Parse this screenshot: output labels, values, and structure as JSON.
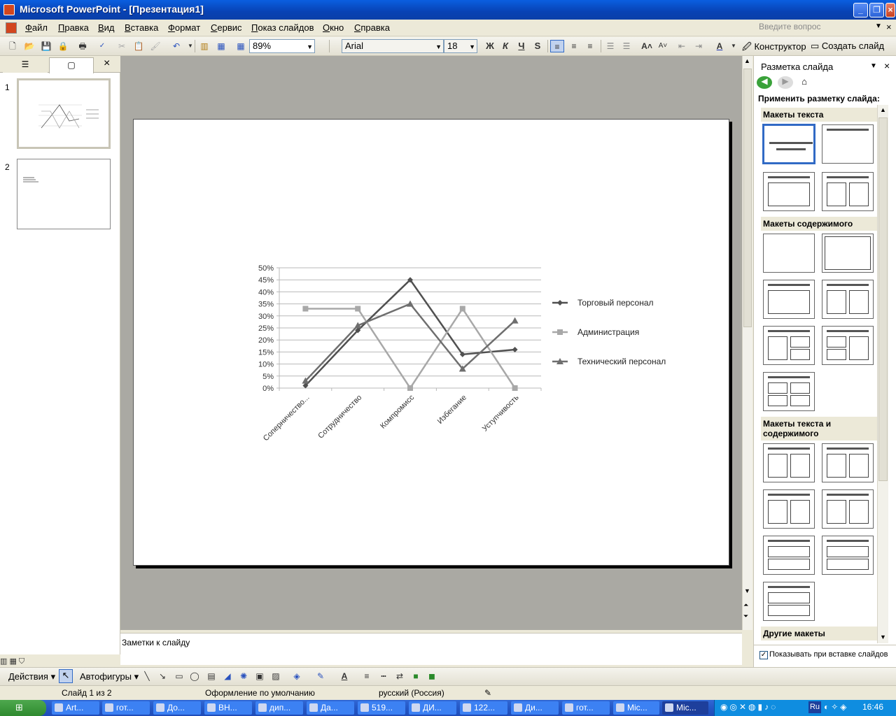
{
  "window": {
    "title": "Microsoft PowerPoint - [Презентация1]",
    "ask_placeholder": "Введите вопрос"
  },
  "menu": [
    "Файл",
    "Правка",
    "Вид",
    "Вставка",
    "Формат",
    "Сервис",
    "Показ слайдов",
    "Окно",
    "Справка"
  ],
  "toolbar": {
    "zoom": "89%",
    "font": "Arial",
    "font_size": "18",
    "bold": "Ж",
    "italic": "К",
    "underline": "Ч",
    "shadow": "S",
    "designer": "Конструктор",
    "new_slide": "Создать слайд"
  },
  "slides_pane": {
    "numbers": [
      "1",
      "2"
    ]
  },
  "chart_data": {
    "type": "line",
    "categories": [
      "Соперничество...",
      "Сотрудничество",
      "Компромисс",
      "Избегание",
      "Уступчивость"
    ],
    "series": [
      {
        "name": "Торговый персонал",
        "values": [
          1,
          24,
          45,
          14,
          16
        ],
        "color": "#505050",
        "marker": "diamond"
      },
      {
        "name": "Администрация",
        "values": [
          33,
          33,
          0,
          33,
          0
        ],
        "color": "#a8a8a8",
        "marker": "square"
      },
      {
        "name": "Технический персонал",
        "values": [
          3,
          26,
          35,
          8,
          28
        ],
        "color": "#6e6e6e",
        "marker": "triangle"
      }
    ],
    "y_ticks": [
      "0%",
      "5%",
      "10%",
      "15%",
      "20%",
      "25%",
      "30%",
      "35%",
      "40%",
      "45%",
      "50%"
    ],
    "ylim": [
      0,
      50
    ],
    "grid": true,
    "legend_position": "right"
  },
  "notes": {
    "placeholder": "Заметки к слайду"
  },
  "taskpane": {
    "title": "Разметка слайда",
    "apply_label": "Применить разметку слайда:",
    "sections": [
      "Макеты текста",
      "Макеты содержимого",
      "Макеты текста и содержимого",
      "Другие макеты"
    ],
    "show_on_insert": "Показывать при вставке слайдов"
  },
  "drawbar": {
    "actions": "Действия",
    "autoshapes": "Автофигуры"
  },
  "status": {
    "slide": "Слайд 1 из 2",
    "design": "Оформление по умолчанию",
    "language": "русский (Россия)"
  },
  "taskbar": {
    "items": [
      "Art...",
      "гот...",
      "До...",
      "ВН...",
      "дип...",
      "Да...",
      "519...",
      "ДИ...",
      "122...",
      "Ди...",
      "гот...",
      "Mic...",
      "Mic..."
    ],
    "lang": "Ru",
    "time": "16:46"
  }
}
